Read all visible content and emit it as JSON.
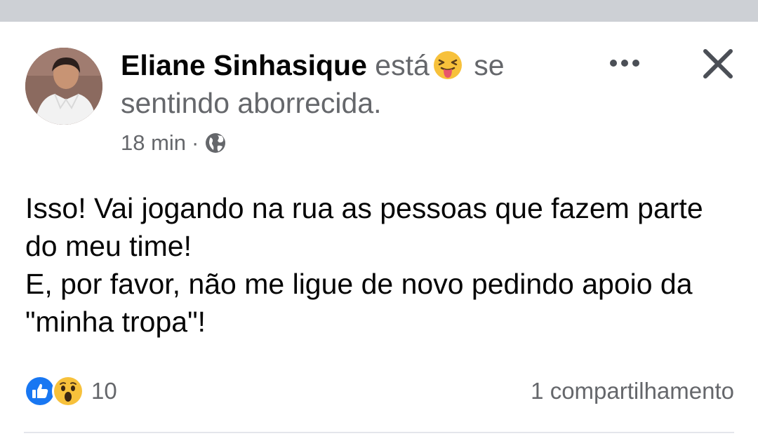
{
  "post": {
    "author": "Eliane Sinhasique",
    "feeling_prefix": "está",
    "feeling_suffix": "se sentindo aborrecida.",
    "feeling_icon": "squinting-tongue-emoji",
    "time": "18 min",
    "separator": "·",
    "privacy_icon": "globe-icon",
    "body_lines": [
      "Isso! Vai jogando na rua as pessoas que fazem parte do meu time!",
      "E, por favor, não me ligue de novo pedindo apoio da \"minha tropa\"!"
    ]
  },
  "actions": {
    "more_icon": "more-dots-icon",
    "close_icon": "close-icon"
  },
  "footer": {
    "reactions": [
      "like",
      "wow"
    ],
    "reaction_count": "10",
    "shares": "1 compartilhamento"
  },
  "colors": {
    "text_primary": "#050505",
    "text_secondary": "#65676b",
    "like_blue": "#1877f2",
    "top_band": "#cdd0d5"
  }
}
